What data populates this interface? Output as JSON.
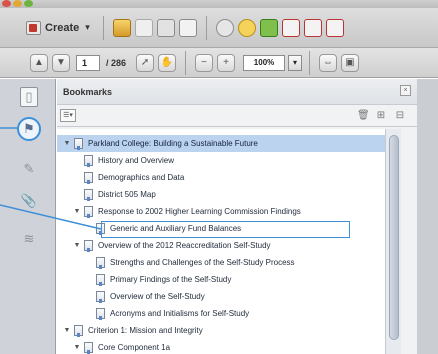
{
  "toolbar": {
    "create_label": "Create",
    "create_arrow": "▾",
    "page_current": "1",
    "page_total": "/ 286",
    "zoom_value": "100%",
    "zoom_arrow": "▾"
  },
  "panel": {
    "title": "Bookmarks",
    "options_label": "☰▾"
  },
  "bookmarks": [
    {
      "label": "Parkland College: Building a Sustainable Future",
      "level": 0,
      "expanded": true,
      "selected": true
    },
    {
      "label": "History and Overview",
      "level": 1
    },
    {
      "label": "Demographics and Data",
      "level": 1
    },
    {
      "label": "District 505 Map",
      "level": 1
    },
    {
      "label": "Response to 2002 Higher Learning Commission Findings",
      "level": 1,
      "expanded": true
    },
    {
      "label": "Generic and Auxiliary Fund Balances",
      "level": 2,
      "highlighted": true
    },
    {
      "label": "Overview of the 2012 Reaccreditation Self-Study",
      "level": 1,
      "expanded": true
    },
    {
      "label": "Strengths and Challenges of the Self-Study Process",
      "level": 2
    },
    {
      "label": "Primary Findings of the Self-Study",
      "level": 2
    },
    {
      "label": "Overview of the Self-Study",
      "level": 2
    },
    {
      "label": "Acronyms and Initialisms for Self-Study",
      "level": 2
    },
    {
      "label": "Criterion 1: Mission and Integrity",
      "level": 0,
      "expanded": true
    },
    {
      "label": "Core Component 1a",
      "level": 1,
      "expanded": true
    }
  ],
  "icons": {
    "accent": "#3e8fd9"
  }
}
